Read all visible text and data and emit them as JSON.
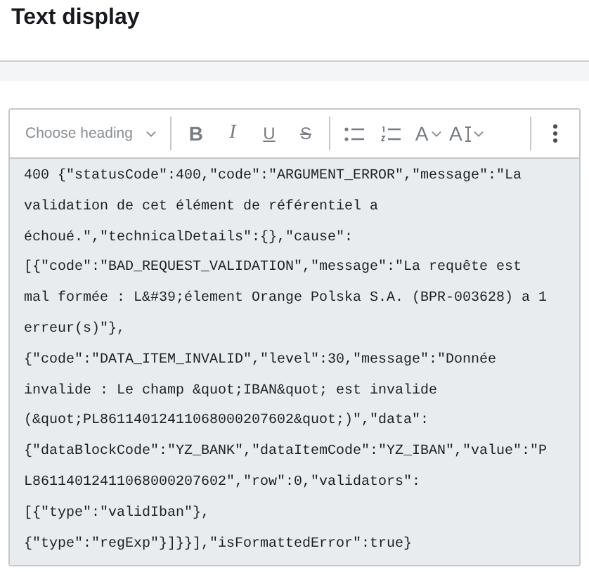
{
  "page": {
    "title": "Text display"
  },
  "toolbar": {
    "heading_dropdown": {
      "placeholder": "Choose heading"
    },
    "groups": [
      [
        {
          "kind": "bold",
          "glyph": "B"
        },
        {
          "kind": "italic",
          "glyph": "I"
        },
        {
          "kind": "underline",
          "glyph": "U"
        },
        {
          "kind": "strike",
          "glyph": "S"
        }
      ],
      [
        {
          "kind": "bullet-list"
        },
        {
          "kind": "numbered-list"
        },
        {
          "kind": "font-family",
          "glyph": "A"
        },
        {
          "kind": "font-size",
          "glyph": "A"
        }
      ],
      [
        {
          "kind": "more"
        }
      ]
    ]
  },
  "content": {
    "lines": [
      "400 {\"statusCode\":400,\"code\":\"ARGUMENT_ERROR\",\"message\":\"La",
      "validation de cet élément de référentiel a",
      "échoué.\",\"technicalDetails\":{},\"cause\":",
      "[{\"code\":\"BAD_REQUEST_VALIDATION\",\"message\":\"La requête est",
      "mal formée : L&#39;élement Orange Polska S.A. (BPR-003628) a 1",
      "erreur(s)\"},",
      "{\"code\":\"DATA_ITEM_INVALID\",\"level\":30,\"message\":\"Donnée",
      "invalide : Le champ &quot;IBAN&quot; est invalide",
      "(&quot;PL86114012411068000207602&quot;)\",\"data\":",
      "{\"dataBlockCode\":\"YZ_BANK\",\"dataItemCode\":\"YZ_IBAN\",\"value\":\"P",
      "L86114012411068000207602\",\"row\":0,\"validators\":",
      "[{\"type\":\"validIban\"},",
      "{\"type\":\"regExp\"}]}}],\"isFormattedError\":true}"
    ]
  }
}
